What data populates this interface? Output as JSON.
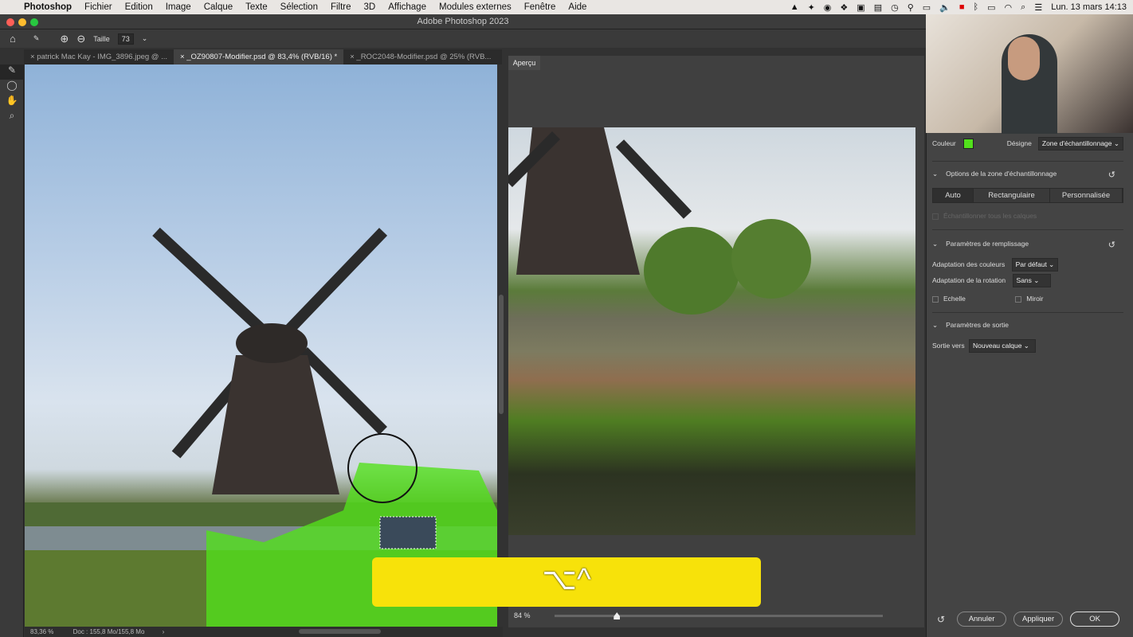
{
  "menubar": {
    "app": "Photoshop",
    "items": [
      "Fichier",
      "Edition",
      "Image",
      "Calque",
      "Texte",
      "Sélection",
      "Filtre",
      "3D",
      "Affichage",
      "Modules externes",
      "Fenêtre",
      "Aide"
    ],
    "datetime": "Lun. 13 mars  14:13"
  },
  "window": {
    "title": "Adobe Photoshop 2023"
  },
  "options": {
    "size_label": "Taille",
    "size_value": "73"
  },
  "tabs": [
    "patrick Mac Kay - IMG_3896.jpeg @ ...",
    "_OZ90807-Modifier.psd @ 83,4% (RVB/16) *",
    "_ROC2048-Modifier.psd @ 25% (RVB..."
  ],
  "active_tab": 1,
  "preview": {
    "title": "Aperçu",
    "zoom": "84 %",
    "zoom_slider_fraction": 0.19
  },
  "status": {
    "zoom": "83,36 %",
    "doc": "Doc : 155,8 Mo/155,8 Mo"
  },
  "panel": {
    "color_label": "Couleur",
    "color": "#52e01c",
    "designe_label": "Désigne",
    "designe_value": "Zone d'échantillonnage",
    "sampling_title": "Options de la zone d'échantillonnage",
    "modes": [
      "Auto",
      "Rectangulaire",
      "Personnalisée"
    ],
    "active_mode": 0,
    "sample_all": "Échantillonner tous les calques",
    "fill_title": "Paramètres de remplissage",
    "color_adapt_label": "Adaptation des couleurs",
    "color_adapt_value": "Par défaut",
    "rotation_label": "Adaptation de la rotation",
    "rotation_value": "Sans",
    "scale_label": "Echelle",
    "mirror_label": "Miroir",
    "output_title": "Paramètres de sortie",
    "output_label": "Sortie vers",
    "output_value": "Nouveau calque",
    "cancel": "Annuler",
    "apply": "Appliquer",
    "ok": "OK"
  },
  "overlay": {
    "keys": "⌥^",
    "color": "#f7e20a"
  }
}
